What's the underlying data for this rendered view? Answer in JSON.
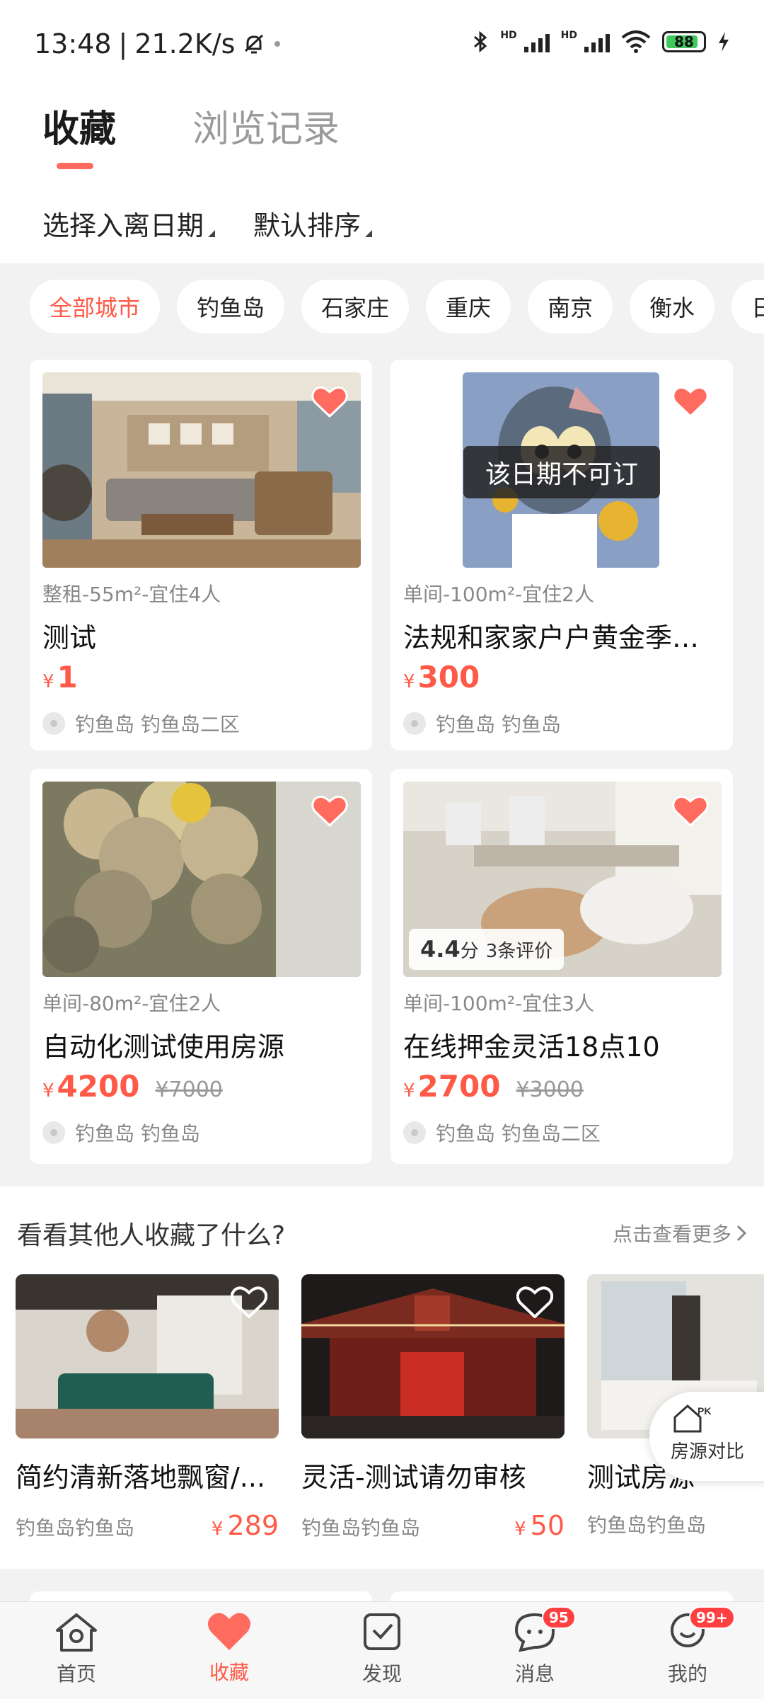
{
  "status_bar": {
    "time": "13:48",
    "speed": "21.2K/s",
    "battery": "88"
  },
  "tabs": {
    "favorites": "收藏",
    "history": "浏览记录"
  },
  "filters": {
    "date": "选择入离日期",
    "sort": "默认排序"
  },
  "cities": [
    "全部城市",
    "钓鱼岛",
    "石家庄",
    "重庆",
    "南京",
    "衡水",
    "日"
  ],
  "listings": [
    {
      "spec": "整租-55m²-宜住4人",
      "title": "测试",
      "price": "1",
      "currency": "¥",
      "original_price": "",
      "location": "钓鱼岛 钓鱼岛二区"
    },
    {
      "spec": "单间-100m²-宜住2人",
      "title": "法规和家家户户黄金季节...",
      "price": "300",
      "currency": "¥",
      "original_price": "",
      "location": "钓鱼岛 钓鱼岛",
      "overlay": "该日期不可订"
    },
    {
      "spec": "单间-80m²-宜住2人",
      "title": "自动化测试使用房源",
      "price": "4200",
      "currency": "¥",
      "original_price": "¥7000",
      "location": "钓鱼岛 钓鱼岛"
    },
    {
      "spec": "单间-100m²-宜住3人",
      "title": "在线押金灵活18点10",
      "price": "2700",
      "currency": "¥",
      "original_price": "¥3000",
      "location": "钓鱼岛 钓鱼岛二区",
      "rating": "4.4",
      "rating_unit": "分",
      "reviews": "3条评价"
    }
  ],
  "others": {
    "title": "看看其他人收藏了什么?",
    "more": "点击查看更多",
    "items": [
      {
        "title": "简约清新落地飘窗/...",
        "location": "钓鱼岛钓鱼岛",
        "price": "289",
        "currency": "¥"
      },
      {
        "title": "灵活-测试请勿审核",
        "location": "钓鱼岛钓鱼岛",
        "price": "50",
        "currency": "¥"
      },
      {
        "title": "测试房源",
        "location": "钓鱼岛钓鱼岛",
        "price": "",
        "currency": ""
      }
    ]
  },
  "compare": {
    "badge": "PK",
    "label": "房源对比"
  },
  "nav": [
    {
      "label": "首页",
      "badge": ""
    },
    {
      "label": "收藏",
      "badge": ""
    },
    {
      "label": "发现",
      "badge": ""
    },
    {
      "label": "消息",
      "badge": "95"
    },
    {
      "label": "我的",
      "badge": "99+"
    }
  ],
  "colors": {
    "accent": "#ff5a48",
    "underline": "#ff6b5e",
    "background": "#f2f2f2"
  }
}
